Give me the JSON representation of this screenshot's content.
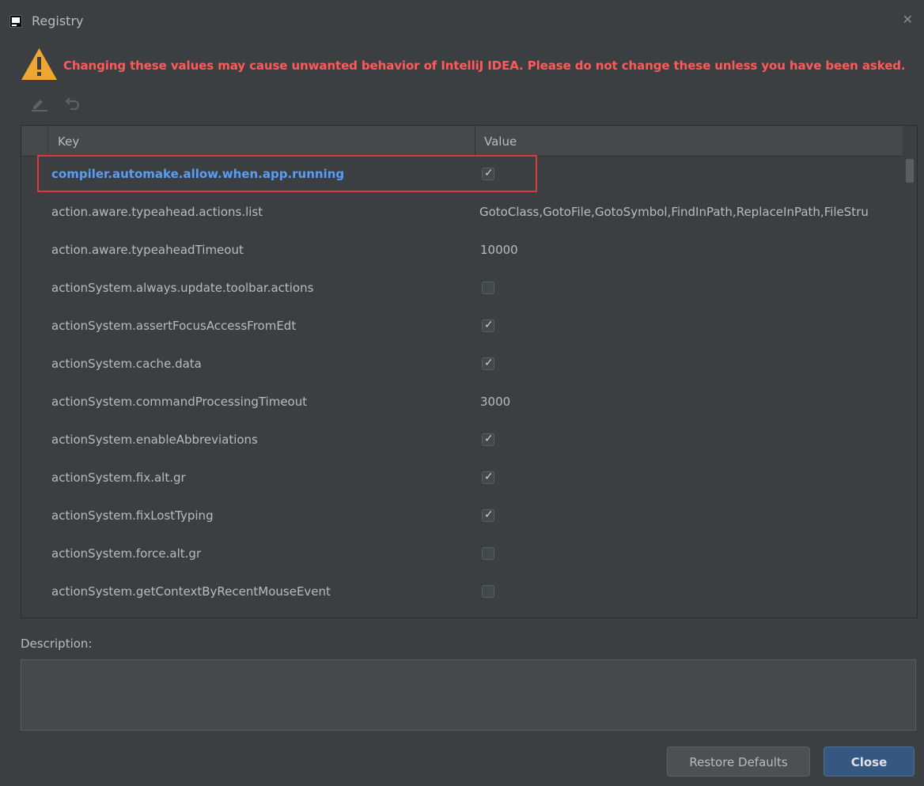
{
  "window": {
    "title": "Registry",
    "close_icon": "close-icon"
  },
  "warning": {
    "icon": "warning-triangle-icon",
    "text": "Changing these values may cause unwanted behavior of IntelliJ IDEA. Please do not change these unless you have been asked.",
    "color": "#ff5a5a"
  },
  "toolbar": {
    "edit_icon": "pencil-icon",
    "undo_icon": "undo-icon"
  },
  "table": {
    "columns": {
      "key": "Key",
      "value": "Value"
    },
    "rows": [
      {
        "key": "compiler.automake.allow.when.app.running",
        "type": "checkbox",
        "checked": true,
        "selected": true
      },
      {
        "key": "action.aware.typeahead.actions.list",
        "type": "text",
        "value": "GotoClass,GotoFile,GotoSymbol,FindInPath,ReplaceInPath,FileStru"
      },
      {
        "key": "action.aware.typeaheadTimeout",
        "type": "text",
        "value": "10000"
      },
      {
        "key": "actionSystem.always.update.toolbar.actions",
        "type": "checkbox",
        "checked": false
      },
      {
        "key": "actionSystem.assertFocusAccessFromEdt",
        "type": "checkbox",
        "checked": true
      },
      {
        "key": "actionSystem.cache.data",
        "type": "checkbox",
        "checked": true
      },
      {
        "key": "actionSystem.commandProcessingTimeout",
        "type": "text",
        "value": "3000"
      },
      {
        "key": "actionSystem.enableAbbreviations",
        "type": "checkbox",
        "checked": true
      },
      {
        "key": "actionSystem.fix.alt.gr",
        "type": "checkbox",
        "checked": true
      },
      {
        "key": "actionSystem.fixLostTyping",
        "type": "checkbox",
        "checked": true
      },
      {
        "key": "actionSystem.force.alt.gr",
        "type": "checkbox",
        "checked": false
      },
      {
        "key": "actionSystem.getContextByRecentMouseEvent",
        "type": "checkbox",
        "checked": false
      }
    ]
  },
  "description": {
    "label": "Description:",
    "text": ""
  },
  "buttons": {
    "restore": "Restore Defaults",
    "close": "Close"
  },
  "colors": {
    "selected_key": "#589df6",
    "highlight_border": "#e0373a",
    "primary_button": "#365880"
  }
}
